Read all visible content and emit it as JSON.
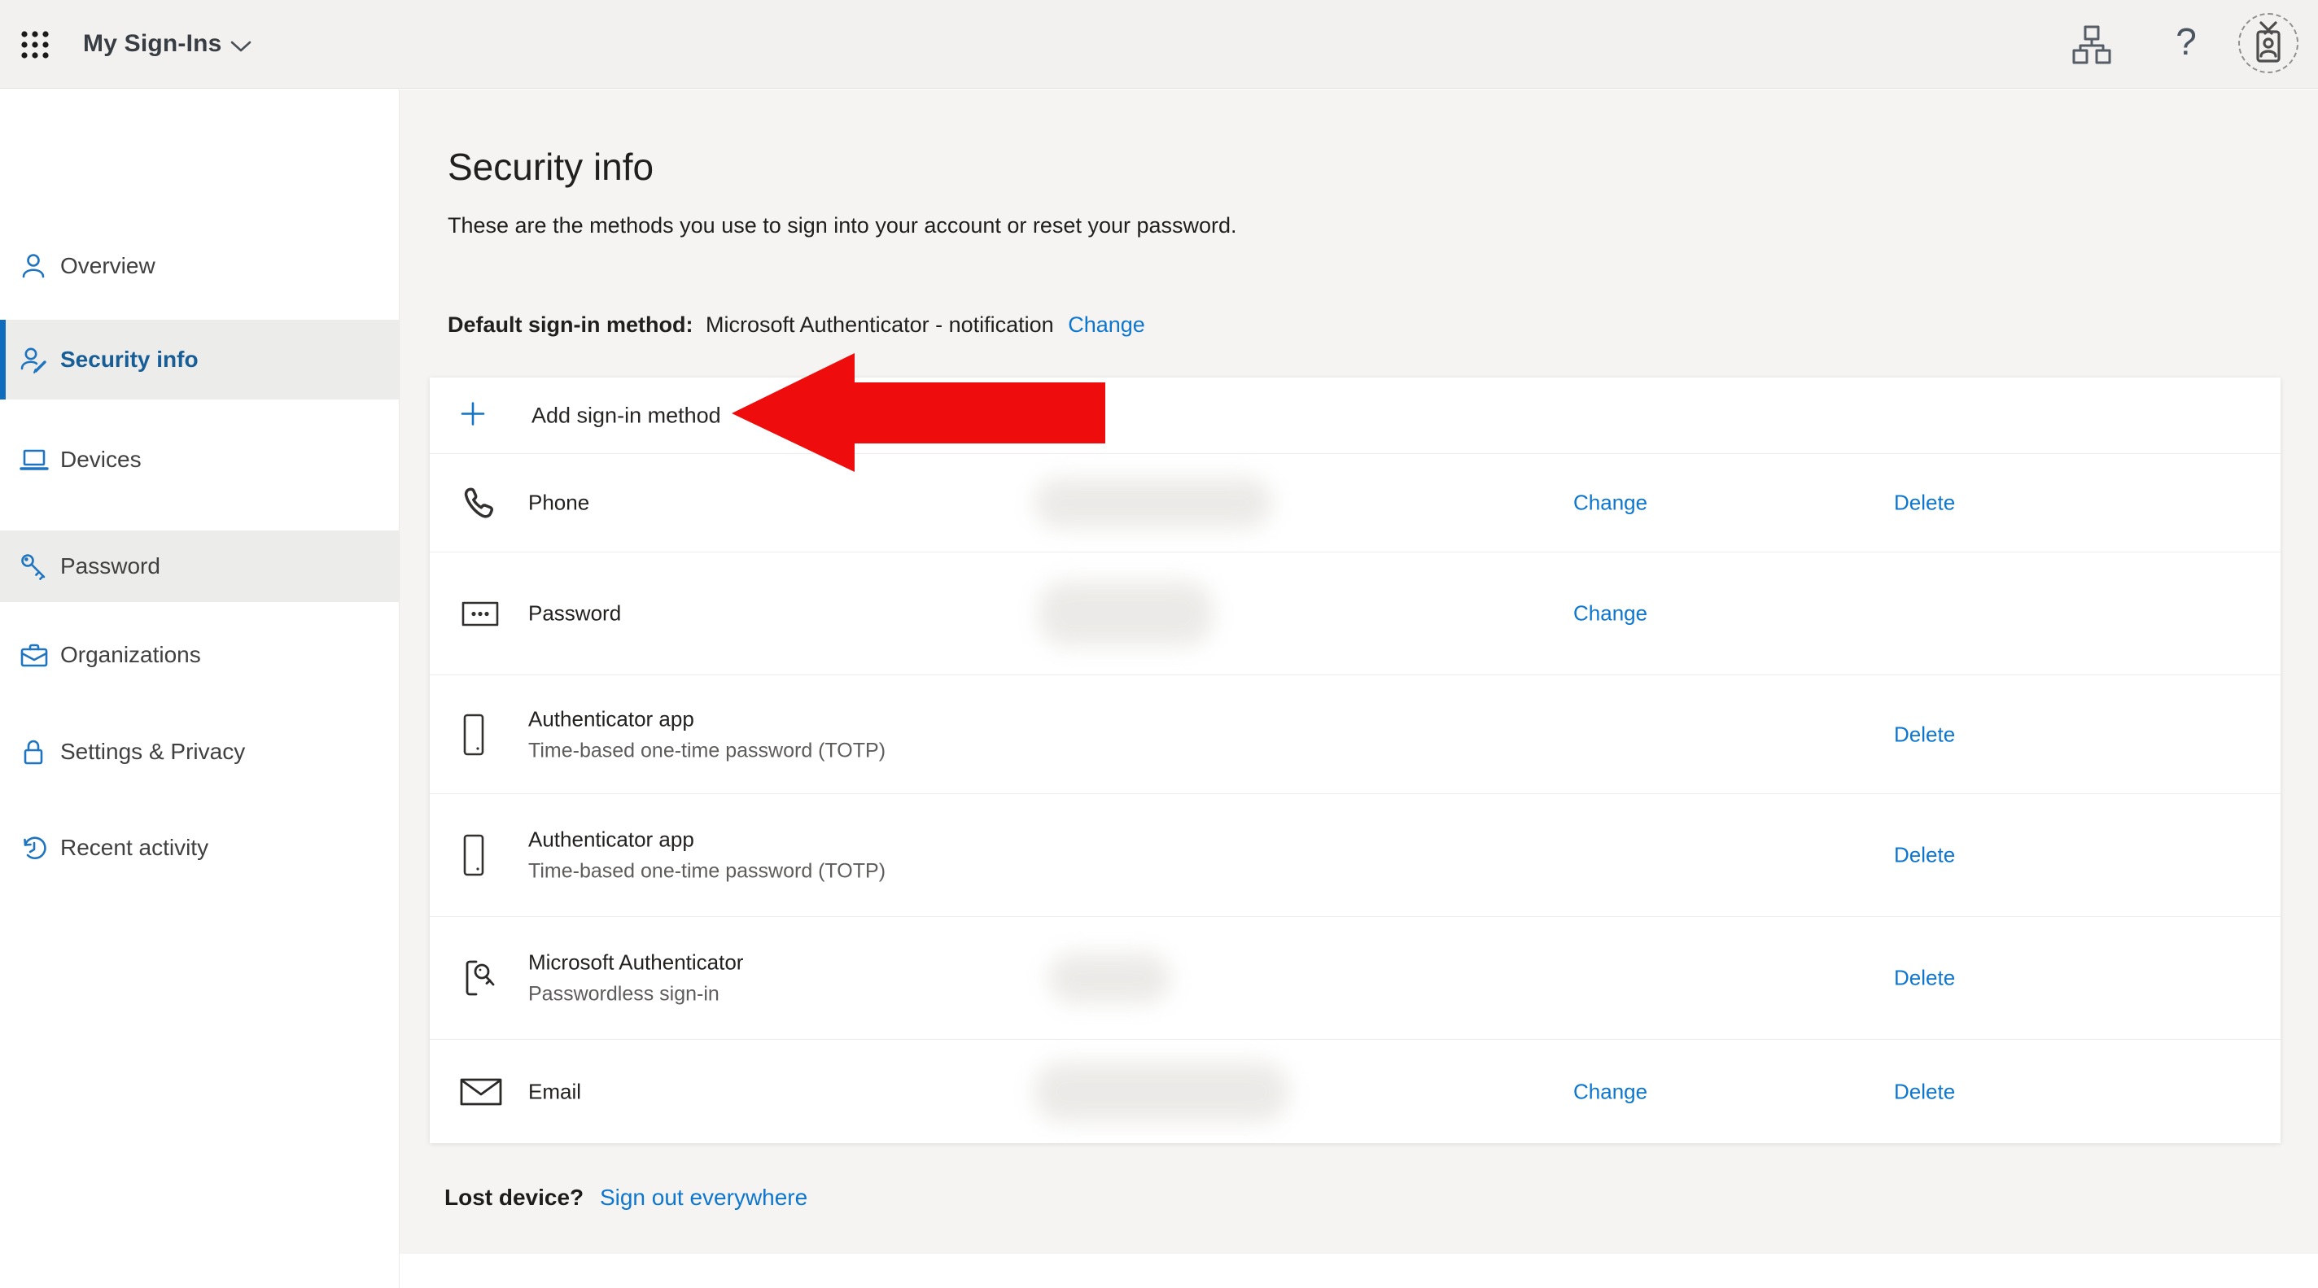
{
  "topbar": {
    "title": "My Sign-Ins",
    "help_label": "?",
    "icons": [
      "app-launcher-waffle-icon",
      "chevron-down-icon",
      "org-chart-icon",
      "help-icon",
      "avatar-id-badge-icon"
    ]
  },
  "sidebar": {
    "items": [
      {
        "label": "Overview",
        "icon": "person-icon",
        "state": "normal"
      },
      {
        "label": "Security info",
        "icon": "person-edit-icon",
        "state": "selected"
      },
      {
        "label": "Devices",
        "icon": "laptop-icon",
        "state": "normal"
      },
      {
        "label": "Password",
        "icon": "key-icon",
        "state": "highlighted"
      },
      {
        "label": "Organizations",
        "icon": "briefcase-icon",
        "state": "normal"
      },
      {
        "label": "Settings & Privacy",
        "icon": "lock-icon",
        "state": "normal"
      },
      {
        "label": "Recent activity",
        "icon": "history-clock-icon",
        "state": "normal"
      }
    ]
  },
  "main": {
    "title": "Security info",
    "subtitle": "These are the methods you use to sign into your account or reset your password.",
    "default_method": {
      "label": "Default sign-in method:",
      "value": "Microsoft Authenticator - notification",
      "change_label": "Change"
    },
    "add_method": {
      "label": "Add sign-in method",
      "icon": "plus-icon"
    },
    "methods": [
      {
        "name": "Phone",
        "icon": "phone-handset-icon",
        "value_redacted": true,
        "change_label": "Change",
        "delete_label": "Delete"
      },
      {
        "name": "Password",
        "icon": "password-dots-icon",
        "value_redacted": true,
        "change_label": "Change"
      },
      {
        "name": "Authenticator app",
        "icon": "smartphone-icon",
        "description": "Time-based one-time password (TOTP)",
        "delete_label": "Delete"
      },
      {
        "name": "Authenticator app",
        "icon": "smartphone-icon",
        "description": "Time-based one-time password (TOTP)",
        "delete_label": "Delete"
      },
      {
        "name": "Microsoft Authenticator",
        "icon": "phone-key-icon",
        "description": "Passwordless sign-in",
        "value_redacted": true,
        "delete_label": "Delete"
      },
      {
        "name": "Email",
        "icon": "envelope-icon",
        "value_redacted": true,
        "change_label": "Change",
        "delete_label": "Delete"
      }
    ],
    "lost_device": {
      "label": "Lost device?",
      "link_label": "Sign out everywhere"
    }
  },
  "annotation": {
    "type": "arrow-left",
    "target": "add-sign-in-method-button",
    "color": "#ee0c0c"
  },
  "colors": {
    "accent_bar": "#0f6cbd",
    "link_blue": "#0d76cf",
    "selected_nav_text": "#175e97",
    "sidebar_icon_blue": "#1f74c0",
    "topbar_bg": "#f2f1ef",
    "main_bg": "#f5f4f2",
    "arrow_red": "#ee0c0c"
  }
}
